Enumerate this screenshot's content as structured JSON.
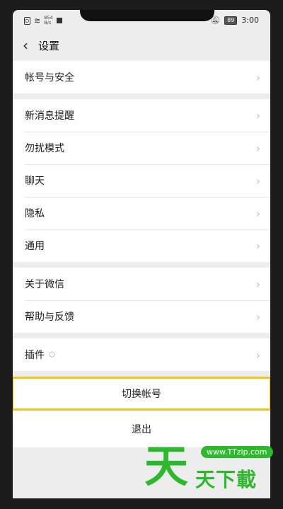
{
  "status_bar": {
    "sim_icon": "D",
    "speed_value": "854",
    "speed_unit": "B/s",
    "battery": "89",
    "time": "3:00"
  },
  "header": {
    "back_glyph": "‹",
    "title": "设置"
  },
  "groups": [
    {
      "items": [
        {
          "label": "帐号与安全"
        }
      ]
    },
    {
      "items": [
        {
          "label": "新消息提醒"
        },
        {
          "label": "勿扰模式"
        },
        {
          "label": "聊天"
        },
        {
          "label": "隐私"
        },
        {
          "label": "通用"
        }
      ]
    },
    {
      "items": [
        {
          "label": "关于微信"
        },
        {
          "label": "帮助与反馈"
        }
      ]
    },
    {
      "items": [
        {
          "label": "插件"
        }
      ]
    }
  ],
  "actions": {
    "switch_account": "切换帐号",
    "logout": "退出"
  },
  "watermark": {
    "big_char": "天",
    "url": "www.TTzip.com",
    "text": "天下載"
  },
  "colors": {
    "highlight": "#f5c21b",
    "watermark": "#2eb82e",
    "background": "#ededed"
  }
}
